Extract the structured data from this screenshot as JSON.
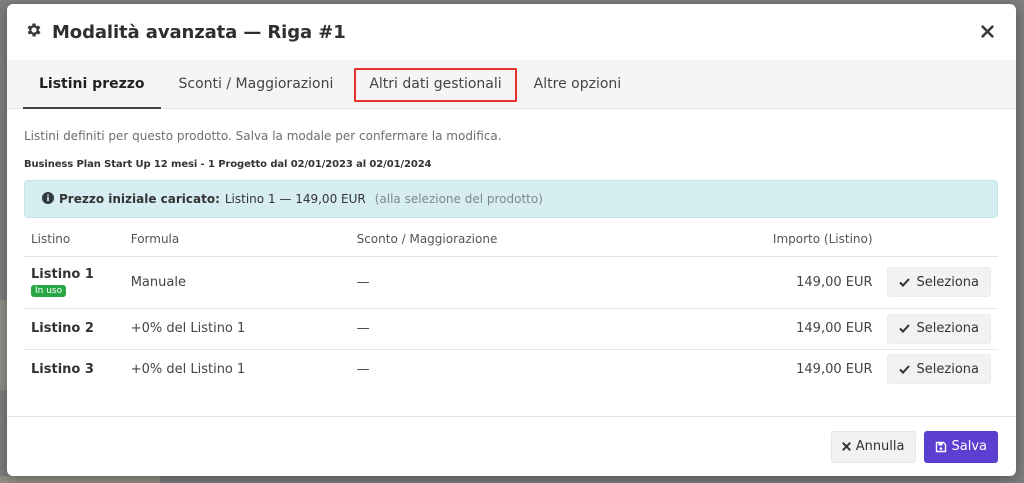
{
  "modal": {
    "title": "Modalità avanzata — Riga #1",
    "icon": "gear-icon",
    "close_icon": "close-icon"
  },
  "tabs": [
    {
      "label": "Listini prezzo",
      "active": true
    },
    {
      "label": "Sconti / Maggiorazioni",
      "active": false
    },
    {
      "label": "Altri dati gestionali",
      "active": false,
      "highlighted": true
    },
    {
      "label": "Altre opzioni",
      "active": false
    }
  ],
  "content": {
    "hint": "Listini definiti per questo prodotto. Salva la modale per confermare la modifica.",
    "product": "Business Plan Start Up 12 mesi - 1 Progetto dal 02/01/2023 al 02/01/2024",
    "alert": {
      "label": "Prezzo iniziale caricato:",
      "value": "Listino 1 — 149,00 EUR",
      "note": "(alla selezione del prodotto)"
    }
  },
  "table": {
    "headers": [
      "Listino",
      "Formula",
      "Sconto / Maggiorazione",
      "Importo (Listino)"
    ],
    "rows": [
      {
        "listino": "Listino 1",
        "badge": "In uso",
        "formula": "Manuale",
        "sconto": "—",
        "importo": "149,00 EUR",
        "action": "Seleziona"
      },
      {
        "listino": "Listino 2",
        "formula": "+0% del Listino 1",
        "sconto": "—",
        "importo": "149,00 EUR",
        "action": "Seleziona"
      },
      {
        "listino": "Listino 3",
        "formula": "+0% del Listino 1",
        "sconto": "—",
        "importo": "149,00 EUR",
        "action": "Seleziona"
      }
    ]
  },
  "footer": {
    "cancel_label": "Annulla",
    "save_label": "Salva"
  },
  "colors": {
    "accent": "#5b3fd1",
    "success": "#28a745",
    "highlight": "#e5322d",
    "info_bg": "#d6eef2"
  }
}
